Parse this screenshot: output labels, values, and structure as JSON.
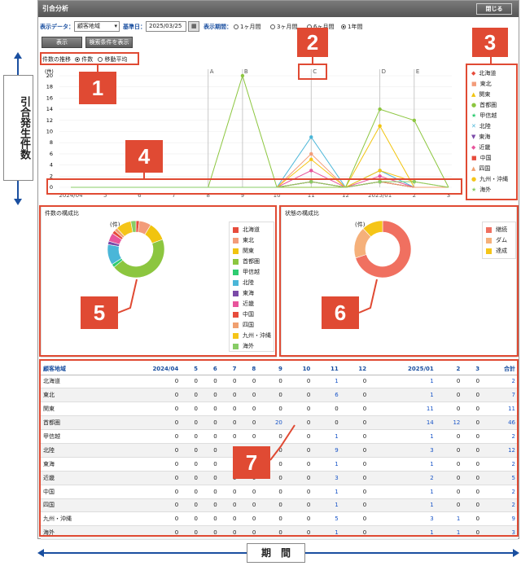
{
  "window": {
    "title": "引合分析",
    "close_label": "閉じる"
  },
  "controls": {
    "data_label": "表示データ：",
    "data_value": "顧客地域",
    "base_date_label": "基準日：",
    "base_date_value": "2025/03/25",
    "period_label": "表示期間：",
    "periods": [
      "1ヶ月間",
      "3ヶ月間",
      "6ヶ月間",
      "1年間"
    ],
    "selected_period": "1年間",
    "show_button": "表示",
    "search_button": "検索条件を表示"
  },
  "chart_options": {
    "label": "件数の推移",
    "options": [
      "件数",
      "移動平均"
    ],
    "selected": "件数"
  },
  "annotations": {
    "side_label": "引合発生件数",
    "bottom_label": "期　間",
    "badges": [
      "1",
      "2",
      "3",
      "4",
      "5",
      "6",
      "7"
    ]
  },
  "colors": {
    "北海道": "#e74c3c",
    "東北": "#f39c7a",
    "関東": "#f1c40f",
    "首都圏": "#8cc63f",
    "甲信越": "#2ecc71",
    "北陸": "#4ab6d8",
    "東海": "#7b4aa8",
    "近畿": "#e8559c",
    "中国": "#e74c3c",
    "四国": "#f0a070",
    "九州・沖縄": "#f5c518",
    "海外": "#88cc66"
  },
  "chart_data": [
    {
      "type": "line",
      "ylabel": "(件)",
      "ylim": [
        0,
        20
      ],
      "y_ticks": [
        0,
        2,
        4,
        6,
        8,
        10,
        12,
        14,
        16,
        18,
        20
      ],
      "categories": [
        "2024/04",
        "5",
        "6",
        "7",
        "8",
        "9",
        "10",
        "11",
        "12",
        "2025/01",
        "2",
        "3"
      ],
      "event_markers": [
        {
          "label": "A",
          "category": "8"
        },
        {
          "label": "B",
          "category": "9"
        },
        {
          "label": "C",
          "category": "11"
        },
        {
          "label": "D",
          "category": "2025/01"
        },
        {
          "label": "E",
          "category": "2"
        }
      ],
      "series": [
        {
          "name": "北海道",
          "values": [
            0,
            0,
            0,
            0,
            0,
            0,
            0,
            1,
            0,
            1,
            0,
            0
          ]
        },
        {
          "name": "東北",
          "values": [
            0,
            0,
            0,
            0,
            0,
            0,
            0,
            6,
            0,
            1,
            0,
            0
          ]
        },
        {
          "name": "関東",
          "values": [
            0,
            0,
            0,
            0,
            0,
            0,
            0,
            0,
            0,
            11,
            0,
            0
          ]
        },
        {
          "name": "首都圏",
          "values": [
            0,
            0,
            0,
            0,
            0,
            20,
            0,
            0,
            0,
            14,
            12,
            0
          ]
        },
        {
          "name": "甲信越",
          "values": [
            0,
            0,
            0,
            0,
            0,
            0,
            0,
            1,
            0,
            1,
            0,
            0
          ]
        },
        {
          "name": "北陸",
          "values": [
            0,
            0,
            0,
            0,
            0,
            0,
            0,
            9,
            0,
            3,
            0,
            0
          ]
        },
        {
          "name": "東海",
          "values": [
            0,
            0,
            0,
            0,
            0,
            0,
            0,
            1,
            0,
            1,
            0,
            0
          ]
        },
        {
          "name": "近畿",
          "values": [
            0,
            0,
            0,
            0,
            0,
            0,
            0,
            3,
            0,
            2,
            0,
            0
          ]
        },
        {
          "name": "中国",
          "values": [
            0,
            0,
            0,
            0,
            0,
            0,
            0,
            1,
            0,
            1,
            0,
            0
          ]
        },
        {
          "name": "四国",
          "values": [
            0,
            0,
            0,
            0,
            0,
            0,
            0,
            1,
            0,
            1,
            0,
            0
          ]
        },
        {
          "name": "九州・沖縄",
          "values": [
            0,
            0,
            0,
            0,
            0,
            0,
            0,
            5,
            0,
            3,
            1,
            0
          ]
        },
        {
          "name": "海外",
          "values": [
            0,
            0,
            0,
            0,
            0,
            0,
            0,
            1,
            0,
            1,
            1,
            0
          ]
        }
      ]
    },
    {
      "type": "pie",
      "title": "件数の構成比",
      "unit": "(件)",
      "labels": [
        "北海道",
        "東北",
        "関東",
        "首都圏",
        "甲信越",
        "北陸",
        "東海",
        "近畿",
        "中国",
        "四国",
        "九州・沖縄",
        "海外"
      ],
      "values": [
        2,
        7,
        11,
        46,
        2,
        12,
        2,
        5,
        2,
        2,
        9,
        3
      ]
    },
    {
      "type": "pie",
      "title": "状態の構成比",
      "unit": "(件)",
      "labels": [
        "継続",
        "ダム",
        "達成"
      ],
      "values": [
        70,
        18,
        12
      ],
      "colors": [
        "#f07060",
        "#f5b07a",
        "#f5c518"
      ]
    }
  ],
  "table": {
    "headers": [
      "顧客地域",
      "2024/04",
      "5",
      "6",
      "7",
      "8",
      "9",
      "10",
      "11",
      "12",
      "2025/01",
      "2",
      "3",
      "合計"
    ],
    "rows": [
      [
        "北海道",
        "0",
        "0",
        "0",
        "0",
        "0",
        "0",
        "0",
        "1",
        "0",
        "1",
        "0",
        "0",
        "2"
      ],
      [
        "東北",
        "0",
        "0",
        "0",
        "0",
        "0",
        "0",
        "0",
        "6",
        "0",
        "1",
        "0",
        "0",
        "7"
      ],
      [
        "関東",
        "0",
        "0",
        "0",
        "0",
        "0",
        "0",
        "0",
        "0",
        "0",
        "11",
        "0",
        "0",
        "11"
      ],
      [
        "首都圏",
        "0",
        "0",
        "0",
        "0",
        "0",
        "20",
        "0",
        "0",
        "0",
        "14",
        "12",
        "0",
        "46"
      ],
      [
        "甲信越",
        "0",
        "0",
        "0",
        "0",
        "0",
        "0",
        "0",
        "1",
        "0",
        "1",
        "0",
        "0",
        "2"
      ],
      [
        "北陸",
        "0",
        "0",
        "0",
        "0",
        "0",
        "0",
        "0",
        "9",
        "0",
        "3",
        "0",
        "0",
        "12"
      ],
      [
        "東海",
        "0",
        "0",
        "0",
        "0",
        "0",
        "0",
        "0",
        "1",
        "0",
        "1",
        "0",
        "0",
        "2"
      ],
      [
        "近畿",
        "0",
        "0",
        "0",
        "0",
        "0",
        "0",
        "0",
        "3",
        "0",
        "2",
        "0",
        "0",
        "5"
      ],
      [
        "中国",
        "0",
        "0",
        "0",
        "0",
        "0",
        "0",
        "0",
        "1",
        "0",
        "1",
        "0",
        "0",
        "2"
      ],
      [
        "四国",
        "0",
        "0",
        "0",
        "0",
        "0",
        "0",
        "0",
        "1",
        "0",
        "1",
        "0",
        "0",
        "2"
      ],
      [
        "九州・沖縄",
        "0",
        "0",
        "0",
        "0",
        "0",
        "0",
        "0",
        "5",
        "0",
        "3",
        "1",
        "0",
        "9"
      ],
      [
        "海外",
        "0",
        "0",
        "0",
        "0",
        "0",
        "0",
        "0",
        "1",
        "0",
        "1",
        "1",
        "0",
        "3"
      ]
    ]
  }
}
